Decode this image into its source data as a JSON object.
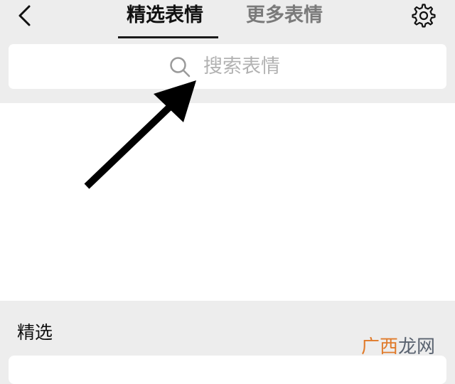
{
  "header": {
    "back_icon": "chevron-left-icon",
    "tabs": [
      {
        "label": "精选表情",
        "active": true
      },
      {
        "label": "更多表情",
        "active": false
      }
    ],
    "settings_icon": "gear-icon"
  },
  "search": {
    "icon": "search-icon",
    "placeholder": "搜索表情"
  },
  "section": {
    "title": "精选"
  },
  "watermark": {
    "part1": "广西",
    "part2": "龙网"
  },
  "colors": {
    "background": "#ededed",
    "surface": "#ffffff",
    "text_primary": "#111111",
    "text_secondary": "#7a7a7a",
    "placeholder": "#b2b2b2",
    "watermark_orange": "#e07a2a",
    "watermark_gray": "#5a6370"
  }
}
